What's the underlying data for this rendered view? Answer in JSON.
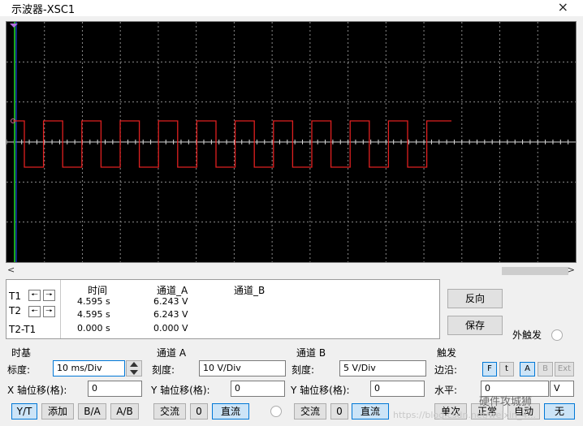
{
  "window": {
    "title": "示波器-XSC1",
    "close_label": "×"
  },
  "scroll": {
    "left": "<",
    "right": ">"
  },
  "readout": {
    "row_labels": [
      "T1",
      "T2",
      "T2-T1"
    ],
    "headers": {
      "time": "时间",
      "channel_a": "通道_A",
      "channel_b": "通道_B"
    },
    "rows": [
      {
        "time": "4.595 s",
        "channel_a": "6.243 V"
      },
      {
        "time": "4.595 s",
        "channel_a": "6.243 V"
      },
      {
        "time": "0.000 s",
        "channel_a": "0.000 V"
      }
    ]
  },
  "buttons": {
    "reverse": "反向",
    "save": "保存",
    "ext_trigger": "外触发"
  },
  "timebase": {
    "title": "时基",
    "scale_label": "标度:",
    "scale_value": "10 ms/Div",
    "xpos_label": "X 轴位移(格):",
    "xpos_value": "0",
    "modes": [
      "Y/T",
      "添加",
      "B/A",
      "A/B"
    ]
  },
  "channel_a": {
    "title": "通道 A",
    "scale_label": "刻度:",
    "scale_value": "10  V/Div",
    "ypos_label": "Y 轴位移(格):",
    "ypos_value": "0",
    "coupling": [
      "交流",
      "0",
      "直流"
    ]
  },
  "channel_b": {
    "title": "通道 B",
    "scale_label": "刻度:",
    "scale_value": "5  V/Div",
    "ypos_label": "Y 轴位移(格):",
    "ypos_value": "0",
    "coupling": [
      "交流",
      "0",
      "直流"
    ]
  },
  "trigger": {
    "title": "触发",
    "edge_label": "边沿:",
    "edge_rising": "F",
    "edge_falling": "t",
    "sources": [
      "A",
      "B",
      "Ext"
    ],
    "level_label": "水平:",
    "level_value": "0",
    "level_unit": "V",
    "modes": [
      "单次",
      "正常",
      "自动",
      "无"
    ]
  },
  "watermark": {
    "text": "硬件攻城狮",
    "url": "https://blog.csdn.net/weixin_4..."
  },
  "colors": {
    "screen": "#000000",
    "grid": "#8a8a8a",
    "channel_a_trace": "#e02020",
    "cursor_t1": "#1aa81a",
    "cursor_t2": "#2050ff"
  }
}
